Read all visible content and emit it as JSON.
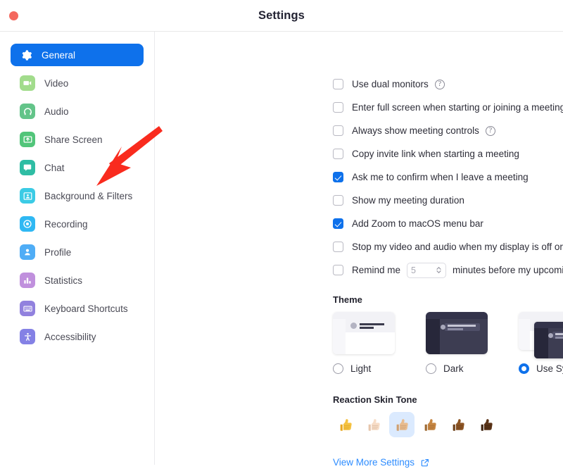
{
  "window": {
    "title": "Settings",
    "close_button": "close",
    "accent_color": "#0e71eb",
    "link_color": "#2d8cff",
    "close_color": "#f4685e"
  },
  "sidebar": {
    "items": [
      {
        "label": "General",
        "icon": "gear-icon",
        "selected": true,
        "icon_color1": "#ffffff",
        "icon_color2": "#ffffff"
      },
      {
        "label": "Video",
        "icon": "video-camera-icon",
        "selected": false,
        "icon_color1": "#a6dd8e",
        "icon_color2": "#8ccf77"
      },
      {
        "label": "Audio",
        "icon": "headphones-icon",
        "selected": false,
        "icon_color1": "#70c98f",
        "icon_color2": "#57bd82"
      },
      {
        "label": "Share Screen",
        "icon": "share-screen-icon",
        "selected": false,
        "icon_color1": "#5ec97f",
        "icon_color2": "#46c06f"
      },
      {
        "label": "Chat",
        "icon": "chat-bubble-icon",
        "selected": false,
        "icon_color1": "#3bc2a8",
        "icon_color2": "#29b9a0"
      },
      {
        "label": "Background & Filters",
        "icon": "background-filters-icon",
        "selected": false,
        "icon_color1": "#4ad1e8",
        "icon_color2": "#32c7e3"
      },
      {
        "label": "Recording",
        "icon": "record-circle-icon",
        "selected": false,
        "icon_color1": "#3ec0f5",
        "icon_color2": "#27b4f2"
      },
      {
        "label": "Profile",
        "icon": "person-icon",
        "selected": false,
        "icon_color1": "#58b3f7",
        "icon_color2": "#46a8f5"
      },
      {
        "label": "Statistics",
        "icon": "bar-chart-icon",
        "selected": false,
        "icon_color1": "#c79ae0",
        "icon_color2": "#bb87da"
      },
      {
        "label": "Keyboard Shortcuts",
        "icon": "keyboard-icon",
        "selected": false,
        "icon_color1": "#9b8ae0",
        "icon_color2": "#8b79da"
      },
      {
        "label": "Accessibility",
        "icon": "accessibility-icon",
        "selected": false,
        "icon_color1": "#8d8ae8",
        "icon_color2": "#7b78e2"
      }
    ]
  },
  "main": {
    "options": [
      {
        "label": "Use dual monitors",
        "checked": false,
        "help": true
      },
      {
        "label": "Enter full screen when starting or joining a meeting",
        "checked": false,
        "help": false
      },
      {
        "label": "Always show meeting controls",
        "checked": false,
        "help": true
      },
      {
        "label": "Copy invite link when starting a meeting",
        "checked": false,
        "help": false
      },
      {
        "label": "Ask me to confirm when I leave a meeting",
        "checked": true,
        "help": false
      },
      {
        "label": "Show my meeting duration",
        "checked": false,
        "help": false
      },
      {
        "label": "Add Zoom to macOS menu bar",
        "checked": true,
        "help": false
      },
      {
        "label": "Stop my video and audio when my display is off or screen saver begins",
        "checked": false,
        "help": false
      }
    ],
    "remind": {
      "checked": false,
      "prefix": "Remind me",
      "value": "5",
      "placeholder": "5",
      "suffix": "minutes before my upcoming meetings"
    },
    "theme": {
      "heading": "Theme",
      "selected": "Use System Setting",
      "options": [
        {
          "label": "Light",
          "selected": false,
          "preview": "light-theme-preview"
        },
        {
          "label": "Dark",
          "selected": false,
          "preview": "dark-theme-preview"
        },
        {
          "label": "Use System Setting",
          "selected": true,
          "preview": "system-theme-preview"
        }
      ]
    },
    "skin_tone": {
      "heading": "Reaction Skin Tone",
      "selected_index": 2,
      "options": [
        {
          "name": "thumbs-up-default",
          "color": "#f5c242",
          "selected": false
        },
        {
          "name": "thumbs-up-light",
          "color": "#f5ddc8",
          "selected": false
        },
        {
          "name": "thumbs-up-medium-light",
          "color": "#e6b98f",
          "selected": true
        },
        {
          "name": "thumbs-up-medium",
          "color": "#c68642",
          "selected": false
        },
        {
          "name": "thumbs-up-medium-dark",
          "color": "#8d5524",
          "selected": false
        },
        {
          "name": "thumbs-up-dark",
          "color": "#5a3317",
          "selected": false
        }
      ]
    },
    "view_more": {
      "label": "View More Settings",
      "icon": "external-link-icon"
    }
  },
  "annotation": {
    "type": "red-arrow",
    "color": "#f92b1e",
    "points_to": "Background & Filters"
  }
}
